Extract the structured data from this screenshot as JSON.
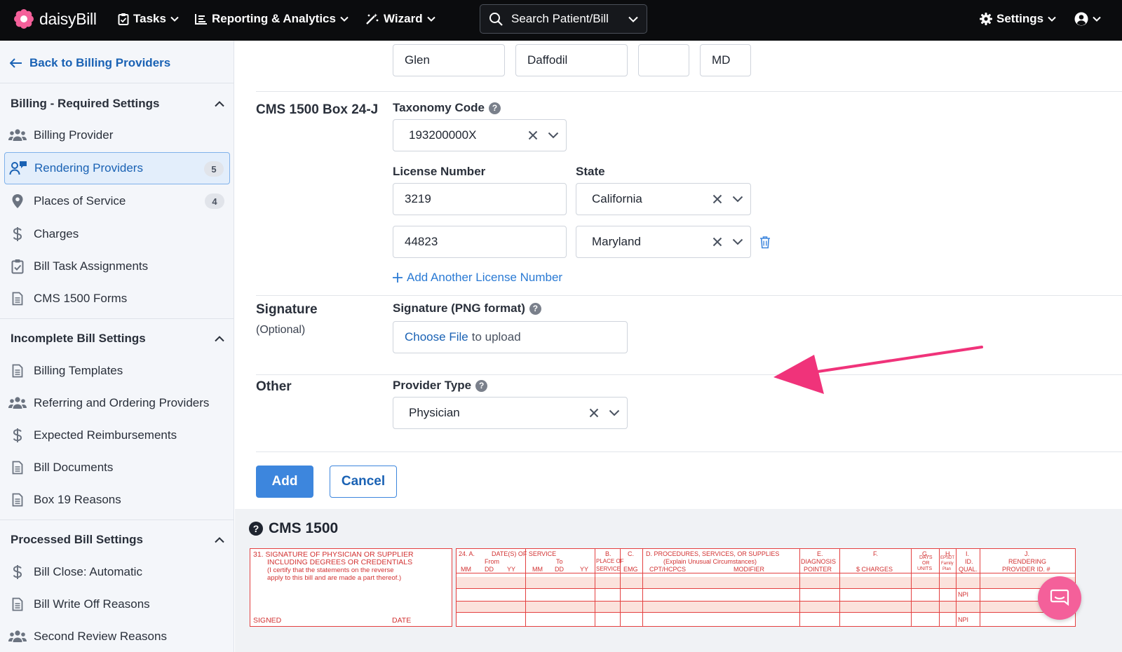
{
  "app": {
    "brand": "daisyBill"
  },
  "nav": {
    "tasks": "Tasks",
    "reporting": "Reporting & Analytics",
    "wizard": "Wizard",
    "search": "Search Patient/Bill",
    "settings": "Settings"
  },
  "sidebar": {
    "back": "Back to Billing Providers",
    "sections": [
      {
        "title": "Billing - Required Settings",
        "items": [
          {
            "label": "Billing Provider",
            "icon": "users-icon"
          },
          {
            "label": "Rendering Providers",
            "icon": "user-chat-icon",
            "badge": "5",
            "active": true
          },
          {
            "label": "Places of Service",
            "icon": "map-pin-icon",
            "badge": "4"
          },
          {
            "label": "Charges",
            "icon": "dollar-icon"
          },
          {
            "label": "Bill Task Assignments",
            "icon": "clipboard-check-icon"
          },
          {
            "label": "CMS 1500 Forms",
            "icon": "document-icon"
          }
        ]
      },
      {
        "title": "Incomplete Bill Settings",
        "items": [
          {
            "label": "Billing Templates",
            "icon": "document-icon"
          },
          {
            "label": "Referring and Ordering Providers",
            "icon": "users-icon"
          },
          {
            "label": "Expected Reimbursements",
            "icon": "dollar-icon"
          },
          {
            "label": "Bill Documents",
            "icon": "document-icon"
          },
          {
            "label": "Box 19 Reasons",
            "icon": "document-icon"
          }
        ]
      },
      {
        "title": "Processed Bill Settings",
        "items": [
          {
            "label": "Bill Close: Automatic",
            "icon": "dollar-icon"
          },
          {
            "label": "Bill Write Off Reasons",
            "icon": "document-icon"
          },
          {
            "label": "Second Review Reasons",
            "icon": "users-icon"
          }
        ]
      }
    ]
  },
  "form": {
    "name_row": {
      "first": "Glen",
      "last": "Daffodil",
      "middle": "",
      "suffix": "MD"
    },
    "box24j": {
      "section": "CMS 1500 Box 24-J",
      "taxonomy_label": "Taxonomy Code",
      "taxonomy_value": "193200000X",
      "license_label": "License Number",
      "state_label": "State",
      "licenses": [
        {
          "number": "3219",
          "state": "California"
        },
        {
          "number": "44823",
          "state": "Maryland"
        }
      ],
      "add_license": "Add Another License Number"
    },
    "signature": {
      "section": "Signature",
      "optional": "(Optional)",
      "label": "Signature (PNG format)",
      "choose": "Choose File",
      "upload_text": "to upload"
    },
    "other": {
      "section": "Other",
      "provider_type_label": "Provider Type",
      "provider_type_value": "Physician"
    },
    "add_button": "Add",
    "cancel_button": "Cancel"
  },
  "preview": {
    "title": "CMS 1500",
    "box31": {
      "line1": "31. SIGNATURE OF PHYSICIAN OR SUPPLIER",
      "line2": "INCLUDING DEGREES OR CREDENTIALS",
      "line3": "(I certify that the statements on the reverse",
      "line4": "apply to this bill and are made a part thereof.)",
      "signed": "SIGNED",
      "date": "DATE"
    },
    "box24": {
      "a": "24. A.",
      "dates": "DATE(S) OF SERVICE",
      "from": "From",
      "to": "To",
      "mm": "MM",
      "dd": "DD",
      "yy": "YY",
      "b": "B.",
      "place": "PLACE OF",
      "service": "SERVICE",
      "c": "C.",
      "emg": "EMG",
      "d": "D. PROCEDURES, SERVICES, OR SUPPLIES",
      "d_sub": "(Explain Unusual Circumstances)",
      "cpt": "CPT/HCPCS",
      "modifier": "MODIFIER",
      "e": "E.",
      "diag": "DIAGNOSIS",
      "pointer": "POINTER",
      "f": "F.",
      "charges": "$ CHARGES",
      "g": "G.",
      "days": "DAYS",
      "or": "OR",
      "units": "UNITS",
      "h": "H.",
      "epsdt": "EPSDT",
      "family": "Family",
      "plan": "Plan",
      "i": "I.",
      "id": "ID.",
      "qual": "QUAL.",
      "j": "J.",
      "rendering": "RENDERING",
      "provider_id": "PROVIDER ID. #",
      "npi": "NPI"
    }
  },
  "colors": {
    "accent": "#1a62b4",
    "button": "#3d86dd",
    "arrow": "#f0337a",
    "form_red": "#e44040",
    "chat": "#f4609a"
  }
}
